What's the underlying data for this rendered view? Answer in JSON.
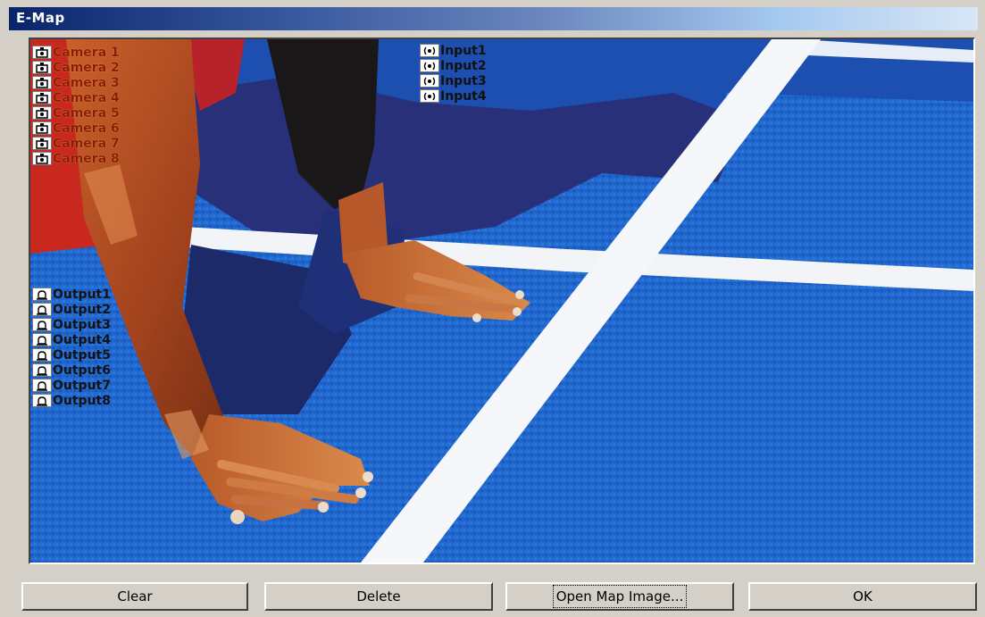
{
  "window": {
    "title": "E-Map"
  },
  "map": {
    "cameras": [
      {
        "label": "Camera 1",
        "icon": "camera-icon"
      },
      {
        "label": "Camera 2",
        "icon": "camera-icon"
      },
      {
        "label": "Camera 3",
        "icon": "camera-icon"
      },
      {
        "label": "Camera 4",
        "icon": "camera-icon"
      },
      {
        "label": "Camera 5",
        "icon": "camera-icon"
      },
      {
        "label": "Camera 6",
        "icon": "camera-icon"
      },
      {
        "label": "Camera 7",
        "icon": "camera-icon"
      },
      {
        "label": "Camera 8",
        "icon": "camera-icon"
      }
    ],
    "inputs": [
      {
        "label": "Input1",
        "icon": "sensor-icon"
      },
      {
        "label": "Input2",
        "icon": "sensor-icon"
      },
      {
        "label": "Input3",
        "icon": "sensor-icon"
      },
      {
        "label": "Input4",
        "icon": "sensor-icon"
      }
    ],
    "outputs": [
      {
        "label": "Output1",
        "icon": "alarm-icon"
      },
      {
        "label": "Output2",
        "icon": "alarm-icon"
      },
      {
        "label": "Output3",
        "icon": "alarm-icon"
      },
      {
        "label": "Output4",
        "icon": "alarm-icon"
      },
      {
        "label": "Output5",
        "icon": "alarm-icon"
      },
      {
        "label": "Output6",
        "icon": "alarm-icon"
      },
      {
        "label": "Output7",
        "icon": "alarm-icon"
      },
      {
        "label": "Output8",
        "icon": "alarm-icon"
      }
    ]
  },
  "buttons": {
    "clear": "Clear",
    "delete": "Delete",
    "open_map": "Open Map Image...",
    "ok": "OK"
  },
  "colors": {
    "title_gradient_start": "#0a246a",
    "dialog_face": "#d4d0c8",
    "track_blue": "#1f63c9",
    "camera_label": "#8a1e05"
  }
}
